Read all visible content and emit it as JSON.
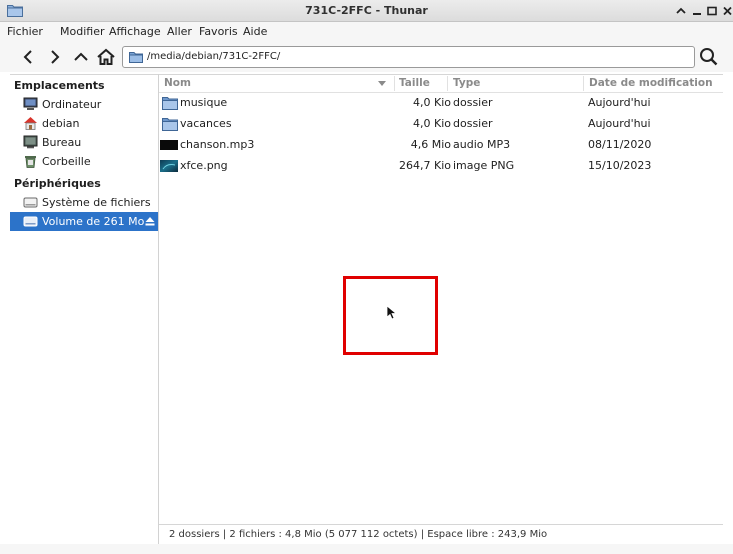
{
  "window": {
    "title": "731C-2FFC - Thunar"
  },
  "menu": [
    "Fichier",
    "Modifier",
    "Affichage",
    "Aller",
    "Favoris",
    "Aide"
  ],
  "location": {
    "path": "/media/debian/731C-2FFC/"
  },
  "sidebar": {
    "places_header": "Emplacements",
    "places": [
      {
        "label": "Ordinateur",
        "icon": "computer-icon"
      },
      {
        "label": "debian",
        "icon": "home-icon"
      },
      {
        "label": "Bureau",
        "icon": "desktop-icon"
      },
      {
        "label": "Corbeille",
        "icon": "trash-icon"
      }
    ],
    "devices_header": "Périphériques",
    "devices": [
      {
        "label": "Système de fichiers",
        "icon": "drive-icon"
      },
      {
        "label": "Volume de 261 Mo",
        "icon": "drive-icon",
        "selected": true
      }
    ]
  },
  "columns": {
    "name": "Nom",
    "size": "Taille",
    "type": "Type",
    "date": "Date de modification"
  },
  "files": [
    {
      "name": "musique",
      "size": "4,0 Kio",
      "type": "dossier",
      "date": "Aujourd'hui",
      "icon": "folder-icon"
    },
    {
      "name": "vacances",
      "size": "4,0 Kio",
      "type": "dossier",
      "date": "Aujourd'hui",
      "icon": "folder-icon"
    },
    {
      "name": "chanson.mp3",
      "size": "4,6 Mio",
      "type": "audio MP3",
      "date": "08/11/2020",
      "icon": "audio-thumbnail-icon"
    },
    {
      "name": "xfce.png",
      "size": "264,7 Kio",
      "type": "image PNG",
      "date": "15/10/2023",
      "icon": "image-thumbnail-icon"
    }
  ],
  "status": {
    "text": "2 dossiers  |  2 fichiers : 4,8 Mio (5 077 112 octets)  |  Espace libre : 243,9 Mio"
  },
  "colors": {
    "selection": "#2c73c9",
    "folder": "#7aa3d4",
    "highlight_box": "#e00000"
  }
}
